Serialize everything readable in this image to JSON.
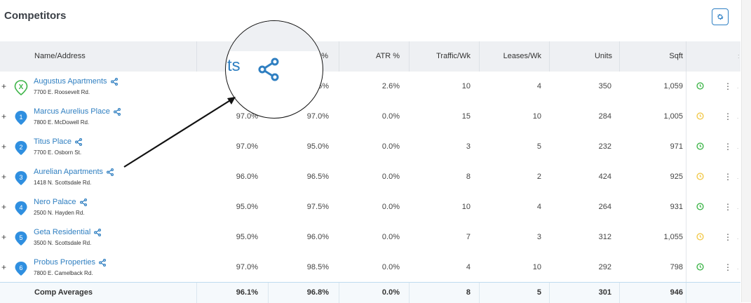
{
  "title": "Competitors",
  "header": {
    "name": "Name/Address",
    "col2": "%",
    "atr": "ATR %",
    "traffic": "Traffic/Wk",
    "leases": "Leases/Wk",
    "units": "Units",
    "sqft": "Sqft"
  },
  "rows": [
    {
      "marker": "X",
      "name": "Augustus Apartments",
      "addr": "7700 E. Roosevelt Rd.",
      "occ": "",
      "occ2": "5%",
      "atr": "2.6%",
      "traffic": "10",
      "leases": "4",
      "units": "350",
      "sqft": "1,059",
      "clock": "#3fb54a"
    },
    {
      "marker": "1",
      "name": "Marcus Aurelius Place",
      "addr": "7800 E. McDowell Rd.",
      "occ": "97.0%",
      "occ2": "97.0%",
      "atr": "0.0%",
      "traffic": "15",
      "leases": "10",
      "units": "284",
      "sqft": "1,005",
      "clock": "#f2c94c"
    },
    {
      "marker": "2",
      "name": "Titus Place",
      "addr": "7700 E. Osborn St.",
      "occ": "97.0%",
      "occ2": "95.0%",
      "atr": "0.0%",
      "traffic": "3",
      "leases": "5",
      "units": "232",
      "sqft": "971",
      "clock": "#3fb54a"
    },
    {
      "marker": "3",
      "name": "Aurelian Apartments",
      "addr": "1418 N. Scottsdale Rd.",
      "occ": "96.0%",
      "occ2": "96.5%",
      "atr": "0.0%",
      "traffic": "8",
      "leases": "2",
      "units": "424",
      "sqft": "925",
      "clock": "#f2c94c"
    },
    {
      "marker": "4",
      "name": "Nero Palace",
      "addr": "2500 N. Hayden Rd.",
      "occ": "95.0%",
      "occ2": "97.5%",
      "atr": "0.0%",
      "traffic": "10",
      "leases": "4",
      "units": "264",
      "sqft": "931",
      "clock": "#3fb54a"
    },
    {
      "marker": "5",
      "name": "Geta Residential",
      "addr": "3500 N. Scottsdale Rd.",
      "occ": "95.0%",
      "occ2": "96.0%",
      "atr": "0.0%",
      "traffic": "7",
      "leases": "3",
      "units": "312",
      "sqft": "1,055",
      "clock": "#f2c94c"
    },
    {
      "marker": "6",
      "name": "Probus Properties",
      "addr": "7800 E. Camelback Rd.",
      "occ": "97.0%",
      "occ2": "98.5%",
      "atr": "0.0%",
      "traffic": "4",
      "leases": "10",
      "units": "292",
      "sqft": "798",
      "clock": "#3fb54a"
    }
  ],
  "footer": {
    "label": "Comp Averages",
    "occ": "96.1%",
    "occ2": "96.8%",
    "atr": "0.0%",
    "traffic": "8",
    "leases": "5",
    "units": "301",
    "sqft": "946"
  },
  "zoom_text": "ts",
  "icons": {
    "settings": "gear-icon",
    "share": "share-icon",
    "clock": "clock-icon",
    "more": "kebab-menu-icon",
    "marker": "map-pin-icon"
  },
  "colors": {
    "accent": "#2f7fc1",
    "pin": "#2f8fe0",
    "subject": "#3fb54a",
    "header_bg": "#eef0f3"
  }
}
